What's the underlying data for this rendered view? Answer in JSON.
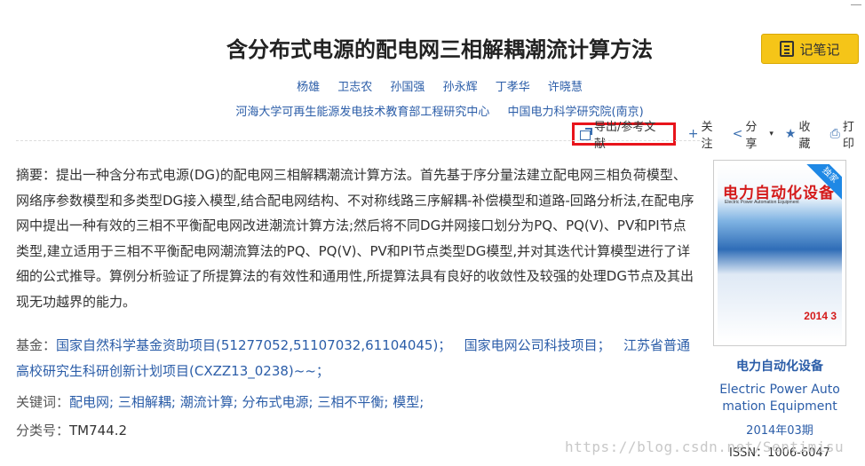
{
  "title": "含分布式电源的配电网三相解耦潮流计算方法",
  "note_button": "记笔记",
  "authors": [
    "杨雄",
    "卫志农",
    "孙国强",
    "孙永辉",
    "丁孝华",
    "许晓慧"
  ],
  "affiliations": [
    "河海大学可再生能源发电技术教育部工程研究中心",
    "中国电力科学研究院(南京)"
  ],
  "toolbar": {
    "export": "导出/参考文献",
    "follow": "关注",
    "share": "分享",
    "collect": "收藏",
    "print": "打印"
  },
  "abstract": {
    "label": "摘要：",
    "text": "提出一种含分布式电源(DG)的配电网三相解耦潮流计算方法。首先基于序分量法建立配电网三相负荷模型、网络序参数模型和多类型DG接入模型,结合配电网结构、不对称线路三序解耦-补偿模型和道路-回路分析法,在配电序网中提出一种有效的三相不平衡配电网改进潮流计算方法;然后将不同DG并网接口划分为PQ、PQ(V)、PV和PI节点类型,建立适用于三相不平衡配电网潮流算法的PQ、PQ(V)、PV和PI节点类型DG模型,并对其迭代计算模型进行了详细的公式推导。算例分析验证了所提算法的有效性和通用性,所提算法具有良好的收敛性及较强的处理DG节点及其出现无功越界的能力。"
  },
  "fund": {
    "label": "基金：",
    "items": [
      "国家自然科学基金资助项目(51277052,51107032,61104045)；",
      "国家电网公司科技项目；",
      "江苏省普通高校研究生科研创新计划项目(CXZZ13_0238)~~；"
    ]
  },
  "keywords": {
    "label": "关键词：",
    "items": [
      "配电网;",
      "三相解耦;",
      "潮流计算;",
      "分布式电源;",
      "三相不平衡;",
      "模型;"
    ]
  },
  "classification": {
    "label": "分类号：",
    "value": "TM744.2"
  },
  "journal": {
    "cover_title": "电力自动化设备",
    "cover_sub": "Electric Power Automation Equipment",
    "cover_corner": "独家",
    "cover_year": "2014 3",
    "name_cn": "电力自动化设备",
    "name_en_line1": "Electric Power Auto",
    "name_en_line2": "mation Equipment",
    "issue": "2014年03期",
    "issn": "ISSN：1006-6047"
  },
  "watermark": "https://blog.csdn.net/Sentimisu"
}
